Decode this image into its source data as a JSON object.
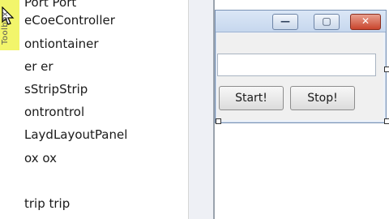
{
  "toolbox": {
    "tab_label": "Toolbox",
    "items": [
      {
        "label": "Port Port"
      },
      {
        "label": "eCoeController"
      },
      {
        "label": "ontiontainer"
      },
      {
        "label": "er er"
      },
      {
        "label": "sStripStrip"
      },
      {
        "label": "ontrontrol"
      },
      {
        "label": "LaydLayoutPanel"
      },
      {
        "label": "ox ox"
      },
      {
        "label": ""
      },
      {
        "label": "trip trip"
      }
    ]
  },
  "form": {
    "title_buttons": {
      "minimize": "—",
      "maximize": "▢",
      "close": "✕"
    },
    "start_label": "Start!",
    "stop_label": "Stop!",
    "textbox_value": ""
  },
  "colors": {
    "toolbox_highlight": "#f2f56b",
    "title_bar": "#c6d7ee",
    "close_button": "#c9452d"
  }
}
